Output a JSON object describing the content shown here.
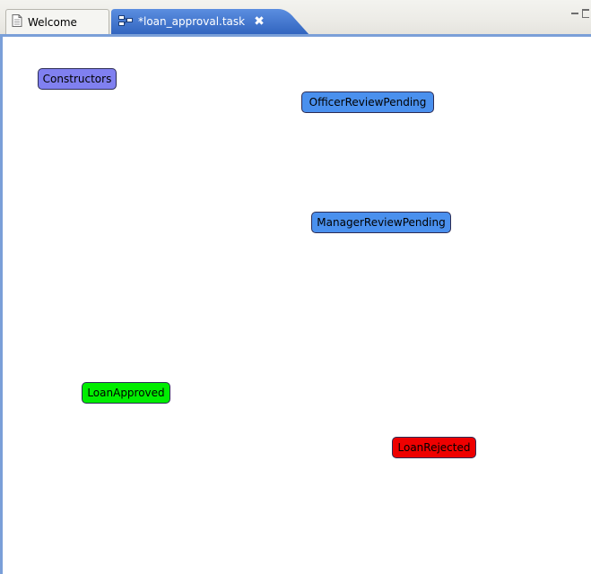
{
  "tabs": {
    "welcome": {
      "label": "Welcome",
      "icon": "document-icon"
    },
    "active": {
      "label": "*loan_approval.task",
      "icon": "task-diagram-icon",
      "close_icon": "close-icon",
      "close_glyph": "✖"
    }
  },
  "view_controls": {
    "minimize_icon": "minimize-icon",
    "maximize_icon": "maximize-icon"
  },
  "diagram": {
    "nodes": [
      {
        "id": "constructors",
        "label": "Constructors",
        "color": "#8080f0"
      },
      {
        "id": "officer-review-pending",
        "label": "OfficerReviewPending",
        "color": "#4a90ee"
      },
      {
        "id": "manager-review-pending",
        "label": "ManagerReviewPending",
        "color": "#4a90ee"
      },
      {
        "id": "loan-approved",
        "label": "LoanApproved",
        "color": "#00ee00"
      },
      {
        "id": "loan-rejected",
        "label": "LoanRejected",
        "color": "#ee0000"
      }
    ]
  },
  "colors": {
    "editor_border": "#7a9fd8",
    "active_tab": "#3f72c8"
  }
}
